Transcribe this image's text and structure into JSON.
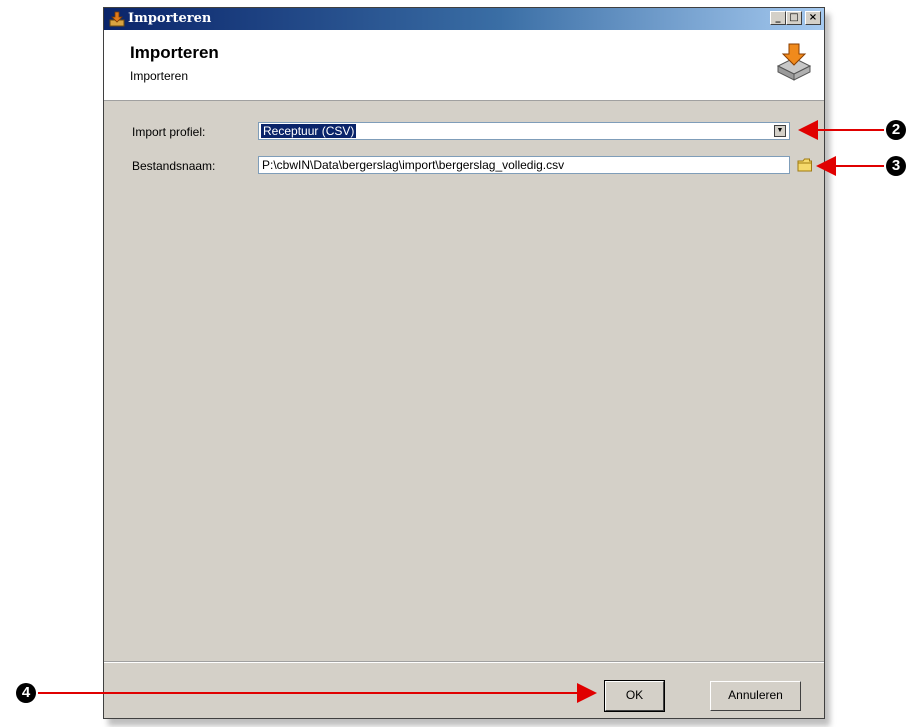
{
  "window": {
    "title": "Importeren",
    "controls": {
      "minimize": "_",
      "maximize": "□",
      "close": "×"
    }
  },
  "header": {
    "title": "Importeren",
    "subtitle": "Importeren",
    "icon": "import-icon"
  },
  "form": {
    "import_profile_label": "Import profiel:",
    "import_profile_value": "Receptuur (CSV)",
    "filename_label": "Bestandsnaam:",
    "filename_value": "P:\\cbwIN\\Data\\bergerslag\\import\\bergerslag_volledig.csv"
  },
  "buttons": {
    "ok": "OK",
    "cancel": "Annuleren"
  },
  "callouts": {
    "c2": "2",
    "c3": "3",
    "c4": "4",
    "arrow_color": "#e00000"
  }
}
